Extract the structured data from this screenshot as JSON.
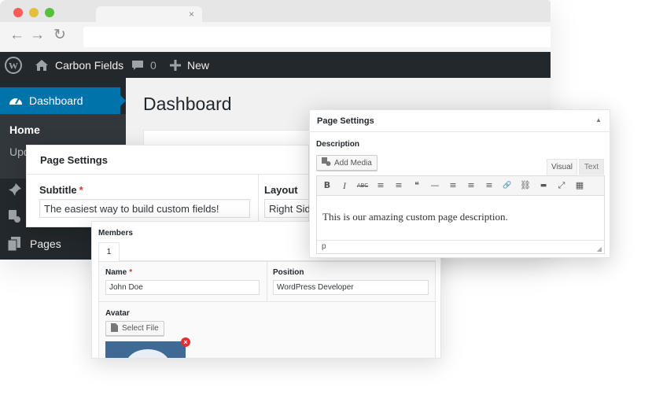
{
  "browser": {
    "tab_close": "×",
    "nav": {
      "back": "←",
      "forward": "→",
      "reload": "↻"
    }
  },
  "adminbar": {
    "site_name": "Carbon Fields",
    "comments_count": "0",
    "new_label": "New"
  },
  "sidebar": {
    "dashboard_label": "Dashboard",
    "home_label": "Home",
    "updates_label": "Upd",
    "pages_label": "Pages"
  },
  "main": {
    "page_title": "Dashboard"
  },
  "page_settings_left": {
    "title": "Page Settings",
    "subtitle_label": "Subtitle",
    "required_mark": "*",
    "subtitle_value": "The easiest way to build custom fields!",
    "layout_label": "Layout",
    "layout_value": "Right Sidebar"
  },
  "members": {
    "title": "Members",
    "tab_1": "1",
    "name_label": "Name",
    "required_mark": "*",
    "name_value": "John Doe",
    "position_label": "Position",
    "position_value": "WordPress Developer",
    "avatar_label": "Avatar",
    "select_file_label": "Select File",
    "remove_mark": "×"
  },
  "page_settings_right": {
    "title": "Page Settings",
    "collapse_mark": "▲",
    "description_label": "Description",
    "add_media_label": "Add Media",
    "tab_visual": "Visual",
    "tab_text": "Text",
    "toolbar": {
      "bold": "B",
      "italic": "I",
      "strike": "ABC",
      "bullets": "≡",
      "numbers": "≡",
      "quote": "❝",
      "hr": "—",
      "align_left": "≡",
      "align_center": "≡",
      "align_right": "≡",
      "link": "🔗",
      "unlink": "⛓",
      "more": "▬",
      "fullscreen": "⤢",
      "kitchen_sink": "▦"
    },
    "body_text": "This is our amazing custom page description.",
    "status_path": "p"
  },
  "colors": {
    "admin_bar": "#23282d",
    "sidebar": "#23282d",
    "submenu": "#32373c",
    "accent_blue": "#0073aa",
    "required_red": "#dc3232"
  }
}
